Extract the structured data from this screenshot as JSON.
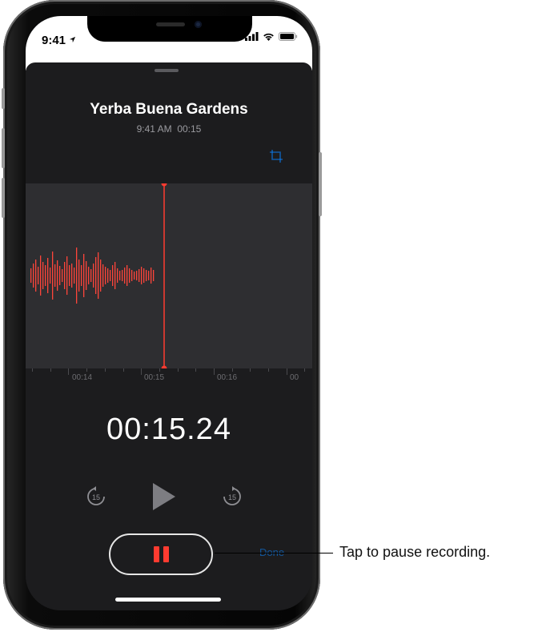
{
  "status_bar": {
    "time": "9:41"
  },
  "recording": {
    "title": "Yerba Buena Gardens",
    "date_time": "9:41 AM",
    "duration": "00:15",
    "elapsed": "00:15.24"
  },
  "timeline": {
    "labels": [
      "00:14",
      "00:15",
      "00:16",
      "00"
    ]
  },
  "controls": {
    "skip_back_seconds": "15",
    "skip_forward_seconds": "15",
    "done_label": "Done"
  },
  "callout": {
    "text": "Tap to pause recording."
  },
  "colors": {
    "accent_red": "#ff3b30",
    "waveform": "#ff453a",
    "background": "#1c1c1e",
    "waveform_bg": "#2e2e31",
    "link_blue": "#0a84ff"
  },
  "icons": {
    "trim": "trim-icon",
    "skip_back": "skip-back-15-icon",
    "play": "play-icon",
    "skip_forward": "skip-forward-15-icon",
    "pause": "pause-icon"
  }
}
